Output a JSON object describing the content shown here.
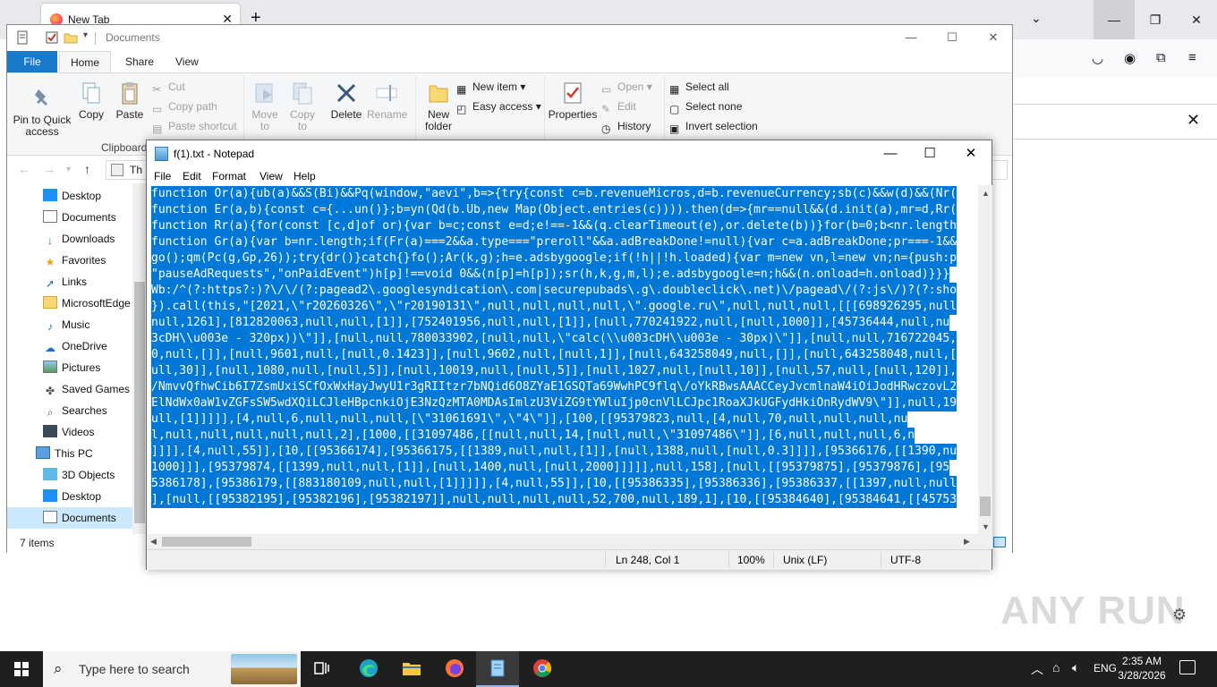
{
  "firefox": {
    "tab_title": "New Tab",
    "watermark": "ANY RUN"
  },
  "explorer": {
    "title": "Documents",
    "ribbon_tabs": [
      "File",
      "Home",
      "Share",
      "View"
    ],
    "clipboard": {
      "pin": "Pin to Quick access",
      "copy": "Copy",
      "paste": "Paste",
      "cut": "Cut",
      "copy_path": "Copy path",
      "paste_shortcut": "Paste shortcut",
      "group_label": "Clipboard"
    },
    "organize": {
      "move_to": "Move to",
      "copy_to": "Copy to",
      "delete": "Delete",
      "rename": "Rename"
    },
    "new": {
      "new_folder": "New folder",
      "new_item": "New item",
      "easy_access": "Easy access"
    },
    "open": {
      "properties": "Properties",
      "open": "Open",
      "edit": "Edit",
      "history": "History"
    },
    "select": {
      "select_all": "Select all",
      "select_none": "Select none",
      "invert": "Invert selection"
    },
    "address_text": "Th",
    "nav_items": [
      "Desktop",
      "Documents",
      "Downloads",
      "Favorites",
      "Links",
      "MicrosoftEdge",
      "Music",
      "OneDrive",
      "Pictures",
      "Saved Games",
      "Searches",
      "Videos",
      "This PC",
      "3D Objects",
      "Desktop",
      "Documents"
    ],
    "status": "7 items"
  },
  "notepad": {
    "title": "f(1).txt - Notepad",
    "menu": [
      "File",
      "Edit",
      "Format",
      "View",
      "Help"
    ],
    "lines": [
      "function Or(a){ub(a)&&S(Bi)&&Pq(window,\"aevi\",b=>{try{const c=b.revenueMicros,d=b.revenueCurrency;sb(c)&&w(d)&&(Nr(",
      "function Er(a,b){const c={...un()};b=yn(Qd(b.Ub,new Map(Object.entries(c)))).then(d=>{mr==null&&(d.init(a),mr=d,Rr(",
      "function Rr(a){for(const [c,d]of or){var b=c;const e=d;e!==-1&&(q.clearTimeout(e),or.delete(b))}for(b=0;b<nr.length",
      "function Gr(a){var b=nr.length;if(Fr(a)===2&&a.type===\"preroll\"&&a.adBreakDone!=null){var c=a.adBreakDone;pr===-1&&",
      "go();qm(Pc(g,Gp,26));try{dr()}catch{}fo();Ar(k,g);h=e.adsbygoogle;if(!h||!h.loaded){var m=new vn,l=new vn;n={push:p",
      "\"pauseAdRequests\",\"onPaidEvent\")h[p]!==void 0&&(n[p]=h[p]);sr(h,k,g,m,l);e.adsbygoogle=n;h&&(n.onload=h.onload)}}}",
      "Wb:/^(?:https?:)?\\/\\/(?:pagead2\\.googlesyndication\\.com|securepubads\\.g\\.doubleclick\\.net)\\/pagead\\/(?:js\\/)?(?:sho",
      "}).call(this,\"[2021,\\\"r20260326\\\",\\\"r20190131\\\",null,null,null,null,\\\".google.ru\\\",null,null,null,[[[698926295,null",
      "null,1261],[812820063,null,null,[1]],[752401956,null,null,[1]],[null,770241922,null,[null,1000]],[45736444,null,nu",
      "3cDH\\\\u003e - 320px))\\\"]],[null,null,780033902,[null,null,\\\"calc(\\\\u003cDH\\\\u003e - 30px)\\\"]],[null,null,716722045,",
      "0,null,[]],[null,9601,null,[null,0.1423]],[null,9602,null,[null,1]],[null,643258049,null,[]],[null,643258048,null,[",
      "ull,30]],[null,1080,null,[null,5]],[null,10019,null,[null,5]],[null,1027,null,[null,10]],[null,57,null,[null,120]],",
      "/NmvvQfhwCib6I7ZsmUxiSCfOxWxHayJwyU1r3gRIItzr7bNQid6O8ZYaE1GSQTa69WwhPC9flq\\/oYkRBwsAAACCeyJvcmlnaW4iOiJodHRwczovL2",
      "ElNdWx0aW1vZGFsSW5wdXQiLCJleHBpcnkiOjE3NzQzMTA0MDAsImlzU3ViZG9tYWluIjp0cnVlLCJpc1RoaXJkUGFydHkiOnRydWV9\\\"]],null,19",
      "ull,[1]]]]],[4,null,6,null,null,null,[\\\"31061691\\\",\\\"4\\\"]],[100,[[95379823,null,[4,null,70,null,null,null,nu",
      "l,null,null,null,null,null,2],[1000,[[31097486,[[null,null,14,[null,null,\\\"31097486\\\"]],[6,null,null,null,6,n",
      "]]]],[4,null,55]],[10,[[95366174],[95366175,[[1389,null,null,[1]],[null,1388,null,[null,0.3]]]],[95366176,[[1390,nu",
      "1000]]],[95379874,[[1399,null,null,[1]],[null,1400,null,[null,2000]]]]],null,158],[null,[[95379875],[95379876],[95",
      "5386178],[95386179,[[883180109,null,null,[1]]]]],[4,null,55]],[10,[[95386335],[95386336],[95386337,[[1397,null,null",
      "],[null,[[95382195],[95382196],[95382197]],null,null,null,null,52,700,null,189,1],[10,[[95384640],[95384641,[[45753"
    ],
    "status": {
      "position": "Ln 248, Col 1",
      "zoom": "100%",
      "eol": "Unix (LF)",
      "encoding": "UTF-8"
    }
  },
  "taskbar": {
    "search_placeholder": "Type here to search",
    "time": "2:35 AM",
    "date": "3/28/2026"
  }
}
